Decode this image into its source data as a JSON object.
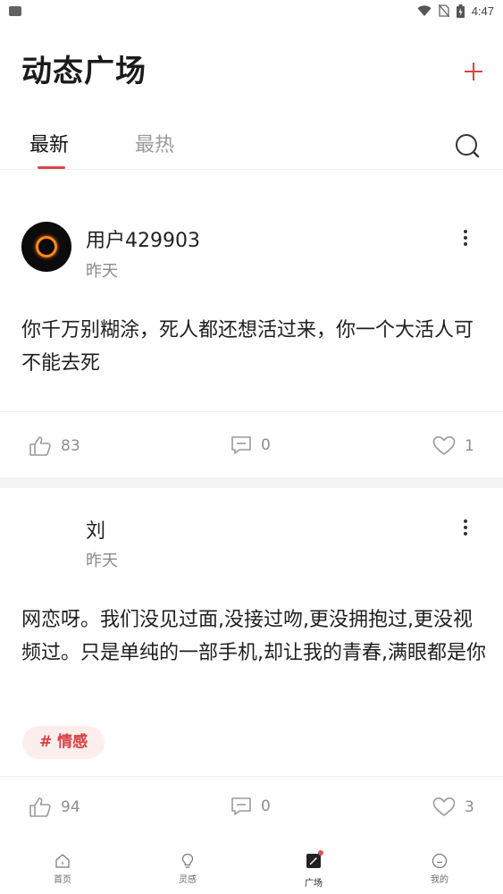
{
  "status_bar": {
    "time": "4:47",
    "icons": [
      "wifi-icon",
      "no-sim-icon",
      "battery-charging-icon"
    ]
  },
  "header": {
    "title": "动态广场",
    "add_icon": "plus-icon",
    "accent_color": "#d64545"
  },
  "tabs": {
    "items": [
      {
        "label": "最新",
        "active": true
      },
      {
        "label": "最热",
        "active": false
      }
    ],
    "search_icon": "search-icon"
  },
  "posts": [
    {
      "username": "用户429903",
      "time": "昨天",
      "content": "你千万别糊涂，死人都还想活过来，你一个大活人可不能去死",
      "likes": "83",
      "comments": "0",
      "favorites": "1"
    },
    {
      "username": "刘",
      "time": "昨天",
      "content": "网恋呀。我们没见过面,没接过吻,更没拥抱过,更没视频过。只是单纯的一部手机,却让我的青春,满眼都是你",
      "tag": "# 情感",
      "likes": "94",
      "comments": "0",
      "favorites": "3"
    }
  ],
  "bottom_nav": {
    "items": [
      {
        "label": "首页",
        "icon": "home-icon"
      },
      {
        "label": "灵感",
        "icon": "lightbulb-icon"
      },
      {
        "label": "广场",
        "icon": "square-feather-icon",
        "active": true,
        "badge": true
      },
      {
        "label": "我的",
        "icon": "smiley-icon"
      }
    ]
  }
}
